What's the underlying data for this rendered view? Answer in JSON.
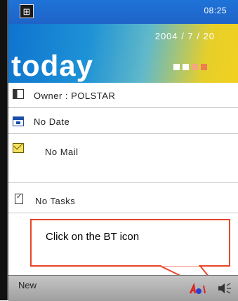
{
  "statusbar": {
    "start_icon": "windows-start-icon",
    "time": "08:25"
  },
  "banner": {
    "date": "2004 / 7 / 20",
    "title": "today"
  },
  "today_items": [
    {
      "icon": "owner-card-icon",
      "label": "Owner : POLSTAR"
    },
    {
      "icon": "calendar-icon",
      "label": "No Date"
    },
    {
      "icon": "mail-icon",
      "label": "No Mail"
    },
    {
      "icon": "tasks-icon",
      "label": "No Tasks"
    }
  ],
  "callout": {
    "text": "Click on the BT icon",
    "border_color": "#e8462a"
  },
  "bottombar": {
    "new_label": "New",
    "bt_icon": "bluetooth-icon",
    "speaker_icon": "speaker-icon"
  },
  "colors": {
    "status_bar": "#1f73d8",
    "banner_left": "#0e74cf",
    "banner_right": "#f2d020"
  }
}
